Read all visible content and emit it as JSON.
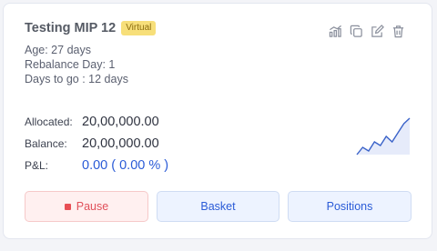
{
  "card": {
    "title": "Testing MIP 12",
    "badge": "Virtual",
    "meta": {
      "age": "Age: 27 days",
      "rebalance": "Rebalance Day: 1",
      "days_to_go": "Days to go : 12 days"
    },
    "stats": {
      "allocated_label": "Allocated:",
      "allocated_value": "20,00,000.00",
      "balance_label": "Balance:",
      "balance_value": "20,00,000.00",
      "pnl_label": "P&L:",
      "pnl_value": "0.00 ( 0.00 % )"
    },
    "actions": [
      "chart-icon",
      "copy-icon",
      "edit-icon",
      "delete-icon"
    ],
    "buttons": {
      "pause": "Pause",
      "basket": "Basket",
      "positions": "Positions"
    },
    "sparkline": [
      2,
      6,
      4,
      9,
      7,
      12,
      9,
      14,
      19,
      22
    ],
    "colors": {
      "accent": "#2a5bd7",
      "pause": "#e84f55",
      "badge": "#f7df7a",
      "sparkline": "#3b63c9"
    }
  }
}
